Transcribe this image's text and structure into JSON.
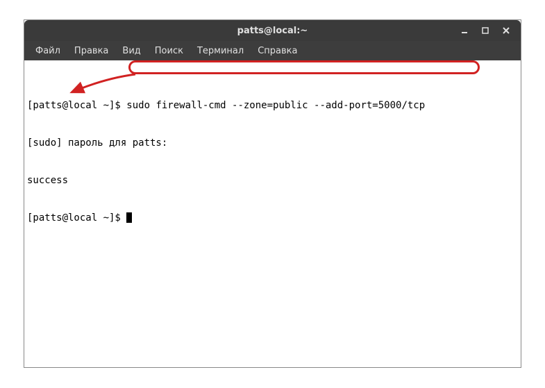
{
  "window": {
    "title": "patts@local:~"
  },
  "menubar": {
    "items": [
      {
        "label": "Файл"
      },
      {
        "label": "Правка"
      },
      {
        "label": "Вид"
      },
      {
        "label": "Поиск"
      },
      {
        "label": "Терминал"
      },
      {
        "label": "Справка"
      }
    ]
  },
  "terminal": {
    "lines": {
      "l0_prompt": "[patts@local ~]$ ",
      "l0_cmd": "sudo firewall-cmd --zone=public --add-port=5000/tcp",
      "l1": "[sudo] пароль для patts:",
      "l2": "success",
      "l3_prompt": "[patts@local ~]$ "
    }
  },
  "annotations": {
    "highlight_color": "#d12222",
    "arrow_points_to": "success"
  }
}
